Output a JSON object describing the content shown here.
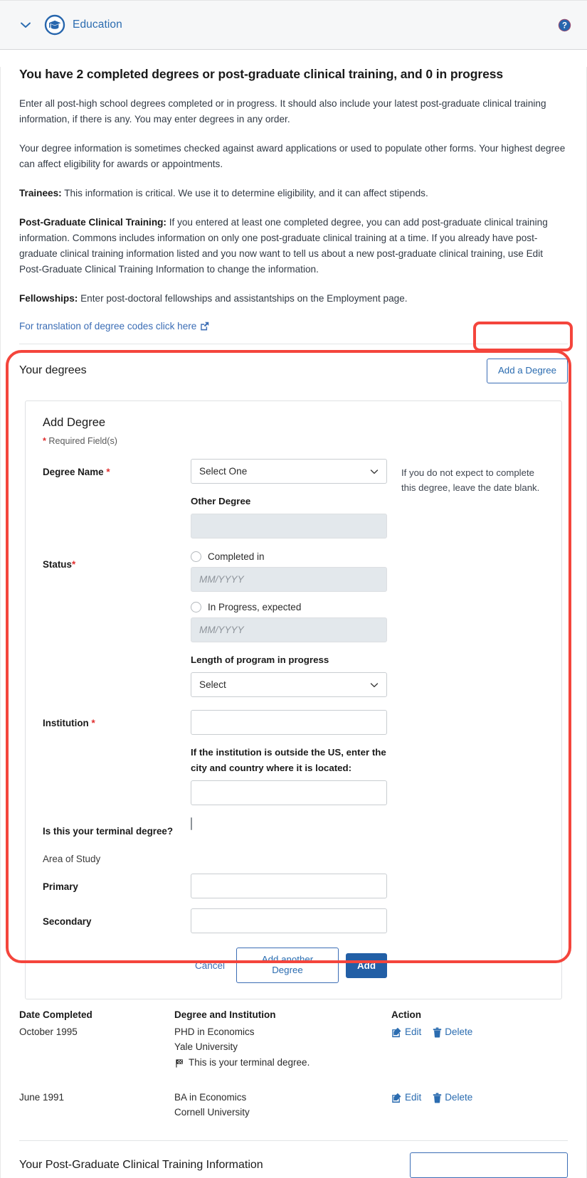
{
  "accordion": {
    "title": "Education",
    "chevron_icon": "chevron-down-icon",
    "section_icon": "graduation-cap-icon",
    "help_icon": "help-circle-icon"
  },
  "colors": {
    "link": "#2b6cb0",
    "primary_button": "#225fa6",
    "required_asterisk": "#e02f2f",
    "highlight": "#f4453c",
    "header_bg": "#f6f7f8"
  },
  "summary": "You have 2 completed degrees or post-graduate clinical training, and 0 in progress",
  "paragraphs": [
    {
      "lead": "",
      "text": "Enter all post-high school degrees completed or in progress. It should also include your latest post-graduate clinical training information, if there is any. You may enter degrees in any order."
    },
    {
      "lead": "",
      "text": "Your degree information is sometimes checked against award applications or used to populate other forms. Your highest degree can affect eligibility for awards or appointments."
    },
    {
      "lead": "Trainees:",
      "text": " This information is critical. We use it to determine eligibility, and it can affect stipends."
    },
    {
      "lead": "Post-Graduate Clinical Training:",
      "text": " If you entered at least one completed degree, you can add post-graduate clinical training information. Commons includes information on only one post-graduate clinical training at a time. If you already have post-graduate clinical training information listed and you now want to tell us about a new post-graduate clinical training, use Edit Post-Graduate Clinical Training Information to change the information."
    },
    {
      "lead": "Fellowships:",
      "text": " Enter post-doctoral fellowships and assistantships on the Employment page."
    }
  ],
  "translation_link": {
    "label": "For translation of degree codes click here",
    "icon": "external-link-icon"
  },
  "your_degrees": {
    "heading": "Your degrees",
    "add_button": "Add a Degree"
  },
  "add_degree_form": {
    "title": "Add Degree",
    "required_note": "Required Field(s)",
    "required_marker": "*",
    "degree_name": {
      "label": "Degree Name",
      "selected": "Select One",
      "options": [
        "Select One"
      ],
      "hint": "If you do not expect to complete this degree, leave the date blank."
    },
    "other_degree": {
      "label": "Other Degree",
      "value": "",
      "placeholder": "",
      "disabled": true
    },
    "status": {
      "label": "Status",
      "completed_radio_label": "Completed in",
      "completed_date_placeholder": "MM/YYYY",
      "completed_date_value": "",
      "inprogress_radio_label": "In Progress, expected",
      "inprogress_date_placeholder": "MM/YYYY",
      "inprogress_date_value": "",
      "length_label": "Length of program in progress",
      "length_selected": "Select",
      "length_options": [
        "Select"
      ]
    },
    "institution": {
      "label": "Institution",
      "value": "",
      "placeholder": "",
      "outside_us_label": "If the institution is outside the US, enter the city and country where it is located:",
      "outside_us_value": "",
      "outside_us_placeholder": ""
    },
    "terminal": {
      "label": "Is this your terminal degree?",
      "checked": false
    },
    "area_of_study": {
      "group_label": "Area of Study",
      "primary_label": "Primary",
      "primary_value": "",
      "secondary_label": "Secondary",
      "secondary_value": ""
    },
    "buttons": {
      "cancel": "Cancel",
      "add_another": "Add another Degree",
      "add": "Add"
    }
  },
  "degrees_table": {
    "headers": [
      "Date Completed",
      "Degree and Institution",
      "Action"
    ],
    "rows": [
      {
        "date": "October 1995",
        "degree": "PHD in Economics",
        "institution": "Yale University",
        "terminal_note": "This is your terminal degree.",
        "terminal_icon": "checkered-flag-icon",
        "edit": "Edit",
        "delete": "Delete"
      },
      {
        "date": "June 1991",
        "degree": "BA in Economics",
        "institution": "Cornell University",
        "terminal_note": "",
        "terminal_icon": "",
        "edit": "Edit",
        "delete": "Delete"
      }
    ]
  },
  "post_grad_section": {
    "heading": "Your Post-Graduate Clinical Training Information",
    "button": ""
  }
}
